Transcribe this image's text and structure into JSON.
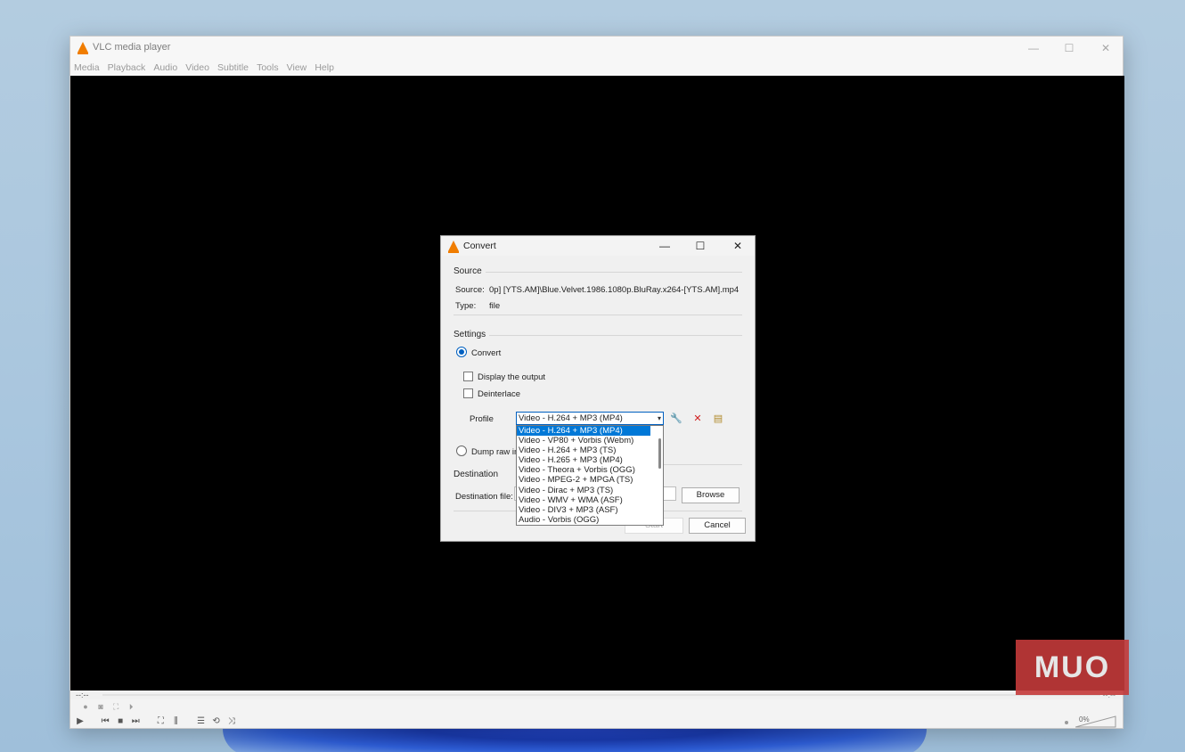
{
  "window": {
    "title": "VLC media player",
    "menu": [
      "Media",
      "Playback",
      "Audio",
      "Video",
      "Subtitle",
      "Tools",
      "View",
      "Help"
    ],
    "minimize": "—",
    "maximize": "☐",
    "close": "✕"
  },
  "player": {
    "time_elapsed": "--:--",
    "time_total": "--:--",
    "volume": "0%"
  },
  "watermark": "MUO",
  "dialog": {
    "title": "Convert",
    "source_group": "Source",
    "source_label": "Source:",
    "source_value": "0p] [YTS.AM]\\Blue.Velvet.1986.1080p.BluRay.x264-[YTS.AM].mp4",
    "type_label": "Type:",
    "type_value": "file",
    "settings_group": "Settings",
    "convert_radio": "Convert",
    "display_output": "Display the output",
    "deinterlace": "Deinterlace",
    "profile_label": "Profile",
    "profile_selected": "Video - H.264 + MP3 (MP4)",
    "profiles": [
      "Video - H.264 + MP3 (MP4)",
      "Video - VP80 + Vorbis (Webm)",
      "Video - H.264 + MP3 (TS)",
      "Video - H.265 + MP3 (MP4)",
      "Video - Theora + Vorbis (OGG)",
      "Video - MPEG-2 + MPGA (TS)",
      "Video - Dirac + MP3 (TS)",
      "Video - WMV + WMA (ASF)",
      "Video - DIV3 + MP3 (ASF)",
      "Audio - Vorbis (OGG)"
    ],
    "dump_raw": "Dump raw in",
    "destination_group": "Destination",
    "destination_label": "Destination file:",
    "browse": "Browse",
    "start": "Start",
    "cancel": "Cancel"
  },
  "colors": {
    "accent": "#0078d7",
    "vlc_orange": "#f07d00",
    "delete_red": "#d02020"
  }
}
